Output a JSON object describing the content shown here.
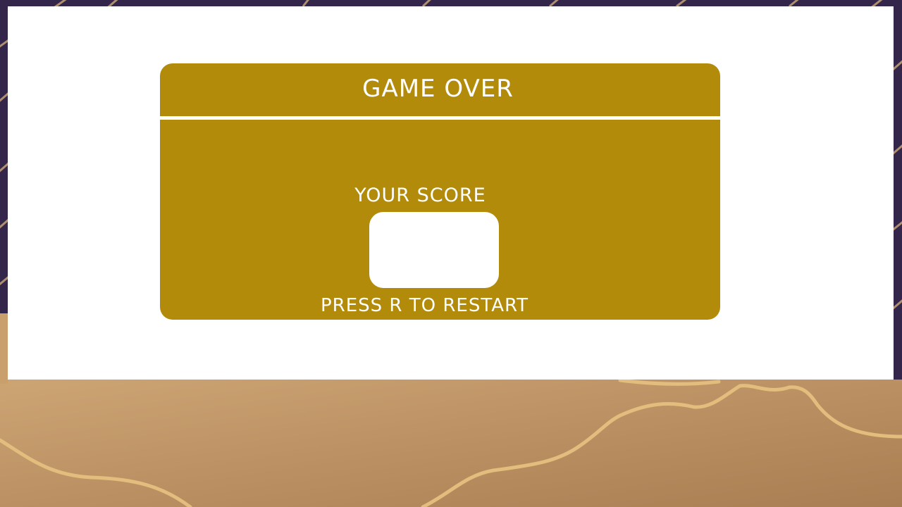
{
  "game": {
    "title": "GAME OVER",
    "score_label": "YOUR SCORE",
    "score_value": "",
    "restart_hint": "PRESS R TO RESTART"
  },
  "colors": {
    "card": "#b28b0a",
    "panel": "#ffffff",
    "sky": "#33264a",
    "sand": "#c9a06b",
    "sand_line": "#e2bd7d"
  }
}
